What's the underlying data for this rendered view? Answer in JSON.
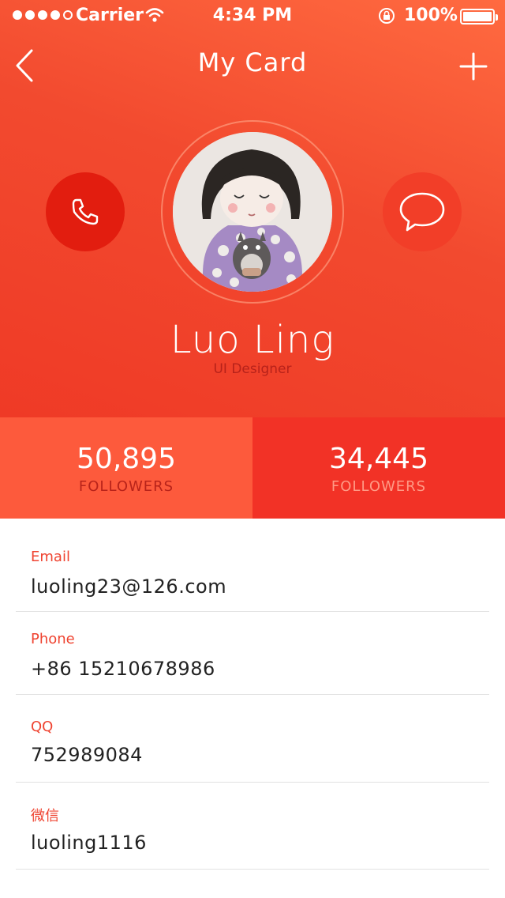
{
  "status_bar": {
    "carrier": "Carrier",
    "time": "4:34 PM",
    "battery": "100%"
  },
  "nav": {
    "title": "My Card"
  },
  "profile": {
    "name": "Luo Ling",
    "role": "UI Designer"
  },
  "stats": [
    {
      "value": "50,895",
      "label": "FOLLOWERS"
    },
    {
      "value": "34,445",
      "label": "FOLLOWERS"
    }
  ],
  "contact": [
    {
      "label": "Email",
      "value": "luoling23@126.com"
    },
    {
      "label": "Phone",
      "value": "+86 15210678986"
    },
    {
      "label": "QQ",
      "value": "752989084"
    },
    {
      "label": "微信",
      "value": "luoling1116"
    }
  ],
  "colors": {
    "accent": "#f24a2f",
    "call_button": "#e21d0f",
    "stat_left": "#fd5a3c",
    "stat_right": "#f23226",
    "label_red": "#ef4330"
  },
  "icons": [
    "back-icon",
    "add-icon",
    "phone-icon",
    "message-icon",
    "wifi-icon",
    "rotation-lock-icon",
    "battery-icon"
  ]
}
